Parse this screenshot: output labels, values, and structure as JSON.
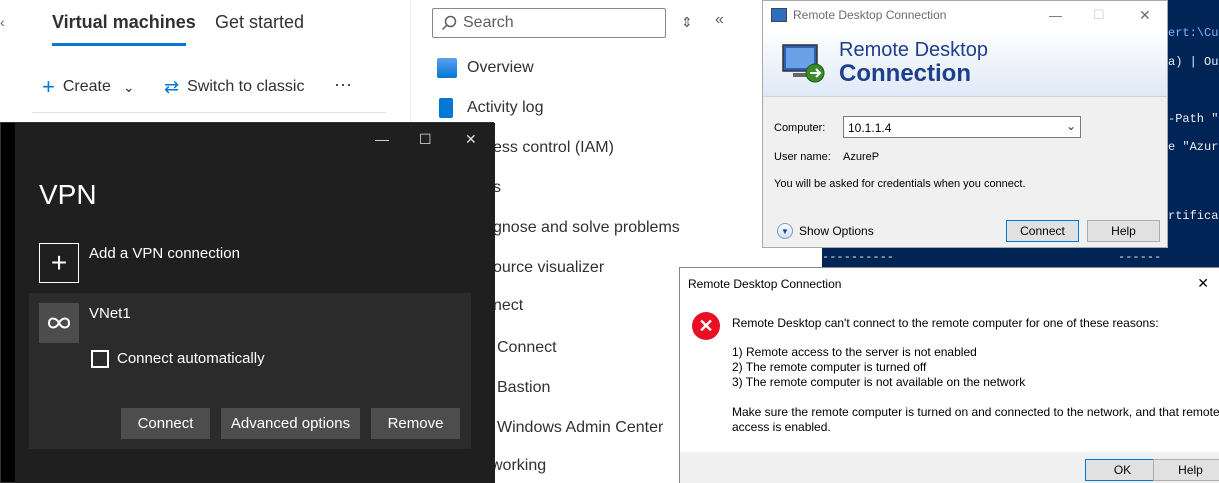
{
  "azure": {
    "tabs": [
      "Virtual machines",
      "Get started"
    ],
    "commands": {
      "create": "Create",
      "switch": "Switch to classic",
      "more": "···"
    },
    "search_placeholder": "Search",
    "menu_items": [
      "Overview",
      "Activity log",
      "ess control (IAM)",
      "s",
      "gnose and solve problems",
      "ource visualizer",
      "nect",
      "Connect",
      "Bastion",
      "Windows Admin Center",
      "working"
    ],
    "accent": "#0078d4"
  },
  "vpn": {
    "title": "VPN",
    "add_label": "Add a VPN connection",
    "connection_name": "VNet1",
    "auto_connect_label": "Connect automatically",
    "auto_connect_checked": false,
    "buttons": [
      "Connect",
      "Advanced options",
      "Remove"
    ]
  },
  "rdp": {
    "window_title": "Remote Desktop Connection",
    "banner_line1": "Remote Desktop",
    "banner_line2": "Connection",
    "computer_label": "Computer:",
    "computer_value": "10.1.1.4",
    "username_label": "User name:",
    "username_value": "AzureP",
    "credentials_note": "You will be asked for credentials when you connect.",
    "show_options": "Show Options",
    "connect_button": "Connect",
    "help_button": "Help"
  },
  "powershell": {
    "lines": [
      "ert:\\Cur",
      "a) | Out",
      "-Path \"C",
      "e \"Azure",
      "rtificate"
    ],
    "dashes_left": "----------",
    "dashes_right": "-------"
  },
  "error_dialog": {
    "title": "Remote Desktop Connection",
    "message": "Remote Desktop can't connect to the remote computer for one of these reasons:",
    "reasons": [
      "1) Remote access to the server is not enabled",
      "2) The remote computer is turned off",
      "3) The remote computer is not available on the network"
    ],
    "advice_line1": "Make sure the remote computer is turned on and connected to the network, and that remote",
    "advice_line2": "access is enabled.",
    "ok_button": "OK",
    "help_button": "Help"
  }
}
